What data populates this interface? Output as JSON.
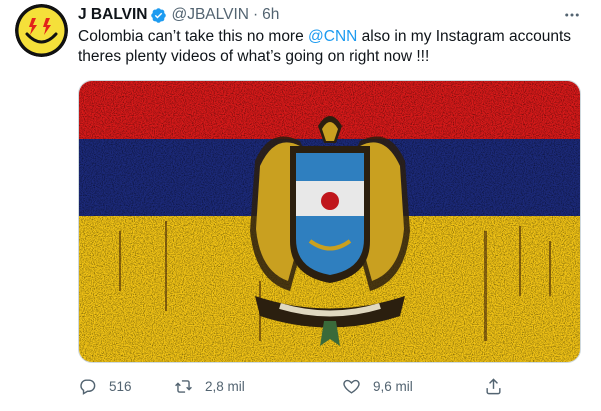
{
  "tweet": {
    "display_name": "J BALVIN",
    "handle": "@JBALVIN",
    "separator": "·",
    "time": "6h",
    "text_before": "Colombia can’t take this no more ",
    "mention": "@CNN",
    "text_after": "  also in my Instagram accounts theres plenty videos of what’s going on right now !!!"
  },
  "actions": {
    "replies": "516",
    "retweets": "2,8 mil",
    "likes": "9,6 mil"
  },
  "colors": {
    "accent": "#1d9bf0",
    "flag_yellow": "#f2c416",
    "flag_blue": "#1c2a7a",
    "flag_red": "#d81a1a",
    "avatar_yellow": "#f5e03a"
  },
  "icons": [
    "smiley-avatar-icon",
    "verified-badge-icon",
    "more-icon",
    "reply-icon",
    "retweet-icon",
    "like-icon",
    "share-icon"
  ]
}
